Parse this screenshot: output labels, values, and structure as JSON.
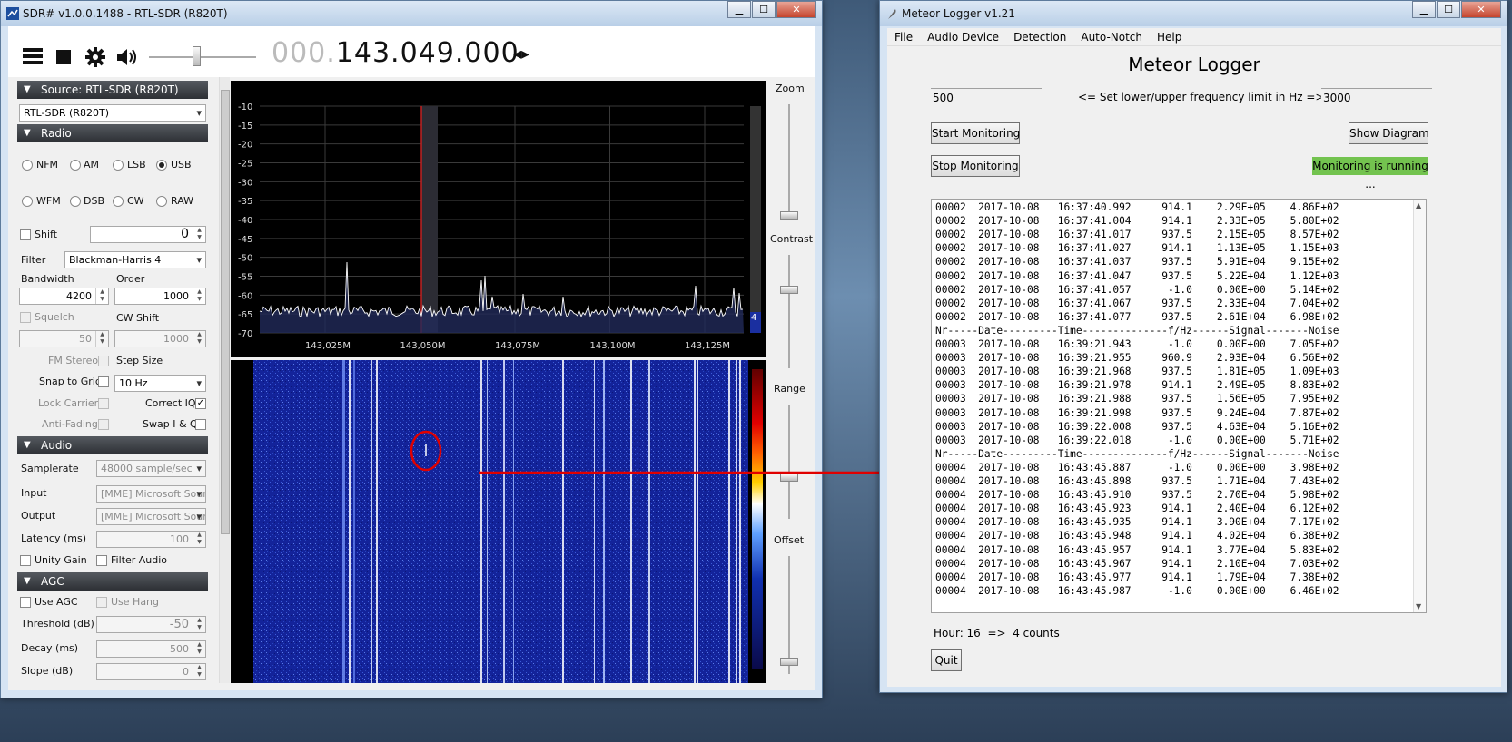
{
  "sdr": {
    "title": "SDR# v1.0.0.1488 - RTL-SDR (R820T)",
    "toolbar": {
      "menu_icon": "hamburger-icon",
      "stop_icon": "stop-icon",
      "settings_icon": "gear-icon",
      "volume_icon": "speaker-icon"
    },
    "freq_dim": "000.",
    "freq_main": "143.049.000",
    "freq_arrows": "◂▸",
    "source_section": "Source: RTL-SDR (R820T)",
    "source_device": "RTL-SDR (R820T)",
    "radio_section": "Radio",
    "modes": [
      "NFM",
      "AM",
      "LSB",
      "USB",
      "WFM",
      "DSB",
      "CW",
      "RAW"
    ],
    "shift_label": "Shift",
    "shift_value": "0",
    "filter_label": "Filter",
    "filter_value": "Blackman-Harris 4",
    "bandwidth_label": "Bandwidth",
    "bandwidth_value": "4200",
    "order_label": "Order",
    "order_value": "1000",
    "squelch_label": "Squelch",
    "squelch_value": "50",
    "cwshift_label": "CW Shift",
    "cwshift_value": "1000",
    "fmstereo_label": "FM Stereo",
    "stepsize_label": "Step Size",
    "snap_label": "Snap to Grid",
    "step_value": "10 Hz",
    "lockcarrier_label": "Lock Carrier",
    "correctiq_label": "Correct IQ",
    "antifading_label": "Anti-Fading",
    "swapiq_label": "Swap I & Q",
    "audio_section": "Audio",
    "samplerate_label": "Samplerate",
    "samplerate_value": "48000 sample/sec",
    "input_label": "Input",
    "input_value": "[MME] Microsoft Soun",
    "output_label": "Output",
    "output_value": "[MME] Microsoft Soun",
    "latency_label": "Latency (ms)",
    "latency_value": "100",
    "unitygain_label": "Unity Gain",
    "filteraudio_label": "Filter Audio",
    "agc_section": "AGC",
    "useagc_label": "Use AGC",
    "usehang_label": "Use Hang",
    "threshold_label": "Threshold (dB)",
    "threshold_value": "-50",
    "decay_label": "Decay (ms)",
    "decay_value": "500",
    "slope_label": "Slope (dB)",
    "slope_value": "0",
    "zoom_label": "Zoom",
    "contrast_label": "Contrast",
    "range_label": "Range",
    "offset_label": "Offset",
    "spectrum_y_ticks": [
      "-10",
      "-15",
      "-20",
      "-25",
      "-30",
      "-35",
      "-40",
      "-45",
      "-50",
      "-55",
      "-60",
      "-65",
      "-70"
    ],
    "spectrum_x_ticks": [
      "143,025M",
      "143,050M",
      "143,075M",
      "143,100M",
      "143,125M"
    ],
    "spectrum_level_badge": "4"
  },
  "logger": {
    "title": "Meteor Logger v1.21",
    "menu": [
      "File",
      "Audio Device",
      "Detection",
      "Auto-Notch",
      "Help"
    ],
    "heading": "Meteor Logger",
    "lower_limit": "500",
    "limit_label": "<= Set lower/upper frequency limit in Hz =>",
    "upper_limit": "3000",
    "start_button": "Start Monitoring",
    "diagram_button": "Show Diagram",
    "stop_button": "Stop Monitoring",
    "status": "Monitoring is running ...",
    "status_color": "#73c34f",
    "log_lines": [
      "00002  2017-10-08   16:37:40.992     914.1    2.29E+05    4.86E+02",
      "00002  2017-10-08   16:37:41.004     914.1    2.33E+05    5.80E+02",
      "00002  2017-10-08   16:37:41.017     937.5    2.15E+05    8.57E+02",
      "00002  2017-10-08   16:37:41.027     914.1    1.13E+05    1.15E+03",
      "00002  2017-10-08   16:37:41.037     937.5    5.91E+04    9.15E+02",
      "00002  2017-10-08   16:37:41.047     937.5    5.22E+04    1.12E+03",
      "00002  2017-10-08   16:37:41.057      -1.0    0.00E+00    5.14E+02",
      "00002  2017-10-08   16:37:41.067     937.5    2.33E+04    7.04E+02",
      "00002  2017-10-08   16:37:41.077     937.5    2.61E+04    6.98E+02",
      "Nr-----Date---------Time--------------f/Hz------Signal-------Noise",
      "00003  2017-10-08   16:39:21.943      -1.0    0.00E+00    7.05E+02",
      "00003  2017-10-08   16:39:21.955     960.9    2.93E+04    6.56E+02",
      "00003  2017-10-08   16:39:21.968     937.5    1.81E+05    1.09E+03",
      "00003  2017-10-08   16:39:21.978     914.1    2.49E+05    8.83E+02",
      "00003  2017-10-08   16:39:21.988     937.5    1.56E+05    7.95E+02",
      "00003  2017-10-08   16:39:21.998     937.5    9.24E+04    7.87E+02",
      "00003  2017-10-08   16:39:22.008     937.5    4.63E+04    5.16E+02",
      "00003  2017-10-08   16:39:22.018      -1.0    0.00E+00    5.71E+02",
      "Nr-----Date---------Time--------------f/Hz------Signal-------Noise",
      "00004  2017-10-08   16:43:45.887      -1.0    0.00E+00    3.98E+02",
      "00004  2017-10-08   16:43:45.898     937.5    1.71E+04    7.43E+02",
      "00004  2017-10-08   16:43:45.910     937.5    2.70E+04    5.98E+02",
      "00004  2017-10-08   16:43:45.923     914.1    2.40E+04    6.12E+02",
      "00004  2017-10-08   16:43:45.935     914.1    3.90E+04    7.17E+02",
      "00004  2017-10-08   16:43:45.948     914.1    4.02E+04    6.38E+02",
      "00004  2017-10-08   16:43:45.957     914.1    3.77E+04    5.83E+02",
      "00004  2017-10-08   16:43:45.967     914.1    2.10E+04    7.03E+02",
      "00004  2017-10-08   16:43:45.977     914.1    1.79E+04    7.38E+02",
      "00004  2017-10-08   16:43:45.987      -1.0    0.00E+00    6.46E+02"
    ],
    "hour_count": "Hour: 16  =>  4 counts",
    "quit_button": "Quit"
  }
}
